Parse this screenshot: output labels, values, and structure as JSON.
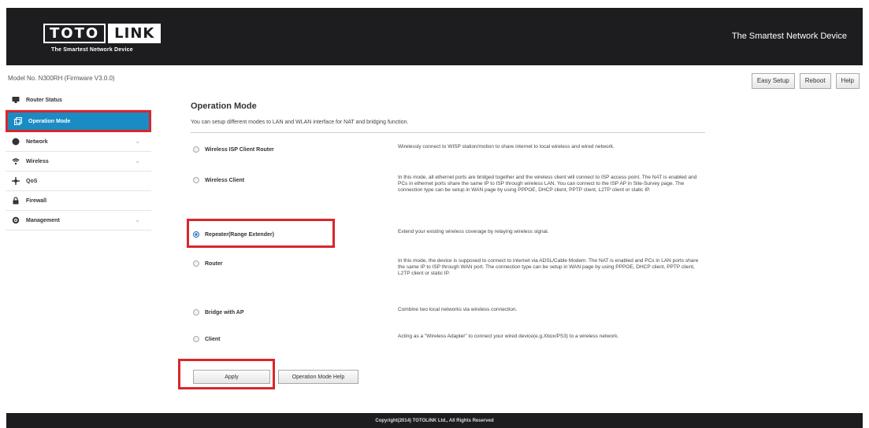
{
  "header": {
    "logo_left": "TOTO",
    "logo_right": "LINK",
    "logo_tagline": "The Smartest Network Device",
    "right_text": "The Smartest Network Device"
  },
  "model_line": "Model No. N300RH (Firmware V3.0.0)",
  "top_buttons": {
    "easy_setup": "Easy Setup",
    "reboot": "Reboot",
    "help": "Help"
  },
  "sidebar": {
    "items": [
      {
        "label": "Router Status",
        "icon": "monitor-icon",
        "chevron": false
      },
      {
        "label": "Operation Mode",
        "icon": "window-icon",
        "chevron": false,
        "active": true
      },
      {
        "label": "Network",
        "icon": "globe-icon",
        "chevron": true
      },
      {
        "label": "Wireless",
        "icon": "wifi-icon",
        "chevron": true
      },
      {
        "label": "QoS",
        "icon": "qos-icon",
        "chevron": false
      },
      {
        "label": "Firewall",
        "icon": "lock-icon",
        "chevron": false
      },
      {
        "label": "Management",
        "icon": "gear-icon",
        "chevron": true
      }
    ],
    "active_color": "#1a8bc3"
  },
  "main": {
    "title": "Operation Mode",
    "description": "You can setup different modes to LAN and WLAN interface for NAT and bridging function.",
    "modes": [
      {
        "label": "Wireless ISP Client Router",
        "desc": "Wirelessly connect to WISP station/motion to share internet to local wireless and wired network.",
        "checked": false
      },
      {
        "label": "Wireless Client",
        "desc": "In this mode, all ethernet ports are bridged together and the wireless client will connect to ISP access point. The NAT is enabled and PCs in ethernet ports share the same IP to ISP through wireless LAN. You can connect to the ISP AP in Site-Survey page. The connection type can be setup in WAN page by using PPPOE, DHCP client, PPTP client, L2TP client or static IP.",
        "checked": false
      },
      {
        "label": "Repeater(Range Extender)",
        "desc": "Extend your existing wireless coverage by relaying wireless signal.",
        "checked": true
      },
      {
        "label": "Router",
        "desc": "In this mode, the device is supposed to connect to internet via ADSL/Cable Modem. The NAT is enabled and PCs in LAN ports share the same IP to ISP through WAN port. The connection type can be setup in WAN page by using PPPOE, DHCP client, PPTP client, L2TP client or static IP.",
        "checked": false
      },
      {
        "label": "Bridge with AP",
        "desc": "Combine two local networks via wireless connection.",
        "checked": false
      },
      {
        "label": "Client",
        "desc": "Acting as a \"Wireless Adapter\" to connect your wired device(e.g.Xbox/PS3) to a wireless network.",
        "checked": false
      }
    ],
    "apply_label": "Apply",
    "help_label": "Operation Mode Help"
  },
  "footer": {
    "copyright": "Copyright(2014) TOTOLINK Ltd., All Rights Reserved"
  },
  "colors": {
    "header_bg": "#1d1d1f",
    "highlight_red": "#d9262c"
  }
}
